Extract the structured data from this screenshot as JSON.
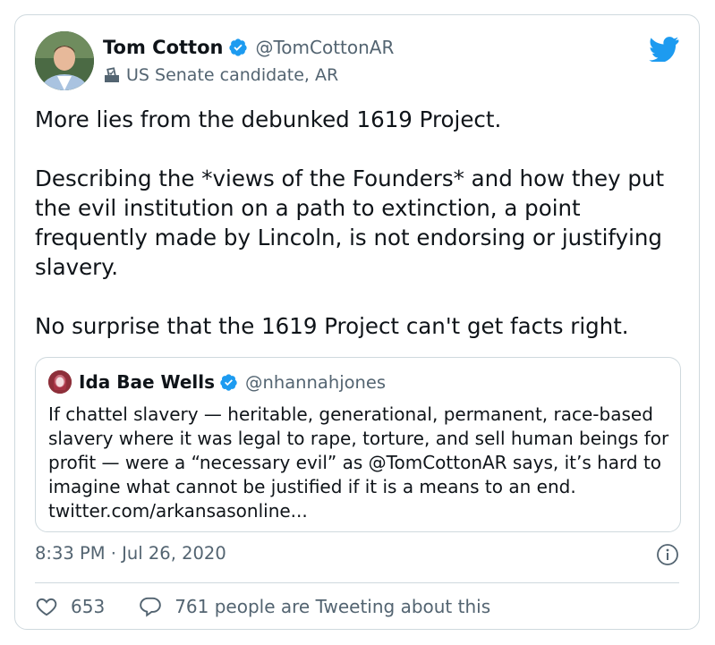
{
  "author": {
    "display_name": "Tom Cotton",
    "handle": "@TomCottonAR",
    "label": "US Senate candidate, AR"
  },
  "tweet": {
    "text": "More lies from the debunked 1619 Project.\n\nDescribing the *views of the Founders* and how they put the evil institution on a path to extinction, a point frequently made by Lincoln, is not endorsing or justifying slavery.\n\nNo surprise that the 1619 Project can't get facts right."
  },
  "quote": {
    "display_name": "Ida Bae Wells",
    "handle": "@nhannahjones",
    "text": "If chattel slavery — heritable, generational, permanent, race-based slavery where it was legal to rape, torture, and sell human beings for profit — were a “necessary evil” as @TomCottonAR says, it’s hard to imagine what cannot be justified if it is a means to an end. twitter.com/arkansasonline..."
  },
  "meta": {
    "timestamp": "8:33 PM · Jul 26, 2020"
  },
  "actions": {
    "likes": "653",
    "conversation": "761 people are Tweeting about this"
  },
  "colors": {
    "brand": "#1d9bf0",
    "text": "#0f1419",
    "secondary": "#536471",
    "border": "#cfd9de"
  }
}
